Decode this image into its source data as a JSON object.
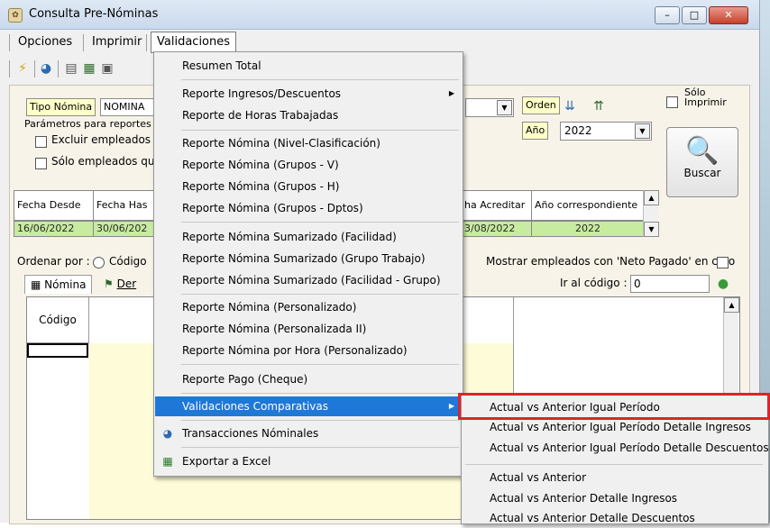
{
  "window": {
    "title": "Consulta Pre-Nóminas",
    "minimize": "–",
    "restore": "□",
    "close": "✕"
  },
  "menubar": [
    "Opciones",
    "Imprimir",
    "Validaciones"
  ],
  "form": {
    "tipo_nomina_label": "Tipo Nómina",
    "tipo_nomina_value": "NOMINA",
    "parametros_label": "Parámetros para reportes c",
    "excluir_label": "Excluir empleados q",
    "solo_emp_label": "Sólo empleados que",
    "orden_label": "Orden",
    "anio_label": "Año",
    "anio_value": "2022",
    "solo_imprimir": "Sólo\nImprimir",
    "buscar": "Buscar"
  },
  "grid_top": {
    "headers": [
      "Fecha Desde",
      "Fecha Has",
      "ha Acreditar",
      "Año correspondiente"
    ],
    "values": [
      "16/06/2022",
      "30/06/202",
      "3/08/2022",
      "2022"
    ]
  },
  "ordenar": {
    "label": "Ordenar por :",
    "option": "Código",
    "mostrar": "Mostrar empleados con 'Neto Pagado' en cero",
    "ir_codigo_label": "Ir al código :",
    "ir_codigo_value": "0"
  },
  "tabs": [
    "Nómina",
    "Der"
  ],
  "datagrid": {
    "col1": "Código"
  },
  "validaciones_menu": {
    "items": [
      "Resumen Total",
      "Reporte Ingresos/Descuentos",
      "Reporte de Horas Trabajadas",
      "Reporte Nómina (Nivel-Clasificación)",
      "Reporte Nómina (Grupos - V)",
      "Reporte Nómina (Grupos - H)",
      "Reporte Nómina (Grupos - Dptos)",
      "Reporte Nómina Sumarizado (Facilidad)",
      "Reporte Nómina Sumarizado (Grupo Trabajo)",
      "Reporte Nómina Sumarizado (Facilidad - Grupo)",
      "Reporte Nómina (Personalizado)",
      "Reporte Nómina (Personalizada II)",
      "Reporte Nómina por Hora (Personalizado)",
      "Reporte Pago (Cheque)",
      "Validaciones Comparativas",
      "Transacciones Nóminales",
      "Exportar a Excel"
    ]
  },
  "submenu": {
    "items": [
      "Actual vs Anterior Igual Período",
      "Actual vs Anterior Igual Período Detalle Ingresos",
      "Actual vs Anterior Igual Período Detalle Descuentos",
      "Actual vs Anterior",
      "Actual vs Anterior Detalle Ingresos",
      "Actual vs Anterior Detalle Descuentos"
    ]
  },
  "colors": {
    "highlight": "#1e78d8",
    "annotation": "#e0222a",
    "grid_green": "#c7eb9f",
    "label_yellow": "#ffffc8"
  }
}
